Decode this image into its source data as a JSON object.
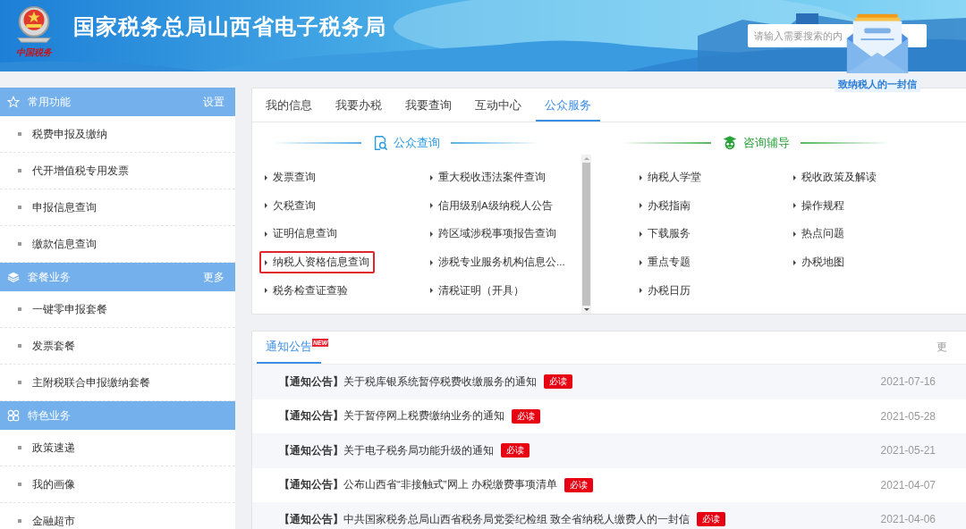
{
  "header": {
    "title": "国家税务总局山西省电子税务局",
    "logo_caption": "中国税务",
    "search": {
      "placeholder": "请输入需要搜索的内"
    },
    "letter": {
      "label": "致纳税人的一封信"
    }
  },
  "sidebar": [
    {
      "title": "常用功能",
      "kind": "star",
      "action": "设置",
      "items": [
        "税费申报及缴纳",
        "代开增值税专用发票",
        "申报信息查询",
        "缴款信息查询"
      ]
    },
    {
      "title": "套餐业务",
      "kind": "layers",
      "action": "更多",
      "items": [
        "一键零申报套餐",
        "发票套餐",
        "主附税联合申报缴纳套餐"
      ]
    },
    {
      "title": "特色业务",
      "kind": "grid",
      "items": [
        "政策速递",
        "我的画像",
        "金融超市"
      ]
    }
  ],
  "tabs": [
    {
      "label": "我的信息",
      "selected": false
    },
    {
      "label": "我要办税",
      "selected": false
    },
    {
      "label": "我要查询",
      "selected": false
    },
    {
      "label": "互动中心",
      "selected": false
    },
    {
      "label": "公众服务",
      "selected": true
    }
  ],
  "sections": [
    {
      "title": "公众查询",
      "kind": "query",
      "links": [
        {
          "label": "发票查询",
          "highlighted": false
        },
        {
          "label": "重大税收违法案件查询",
          "highlighted": false
        },
        {
          "label": "欠税查询",
          "highlighted": false
        },
        {
          "label": "信用级别A级纳税人公告",
          "highlighted": false
        },
        {
          "label": "证明信息查询",
          "highlighted": false
        },
        {
          "label": "跨区域涉税事项报告查询",
          "highlighted": false
        },
        {
          "label": "纳税人资格信息查询",
          "highlighted": true
        },
        {
          "label": "涉税专业服务机构信息公...",
          "highlighted": false
        },
        {
          "label": "税务检查证查验",
          "highlighted": false
        },
        {
          "label": "清税证明（开具）",
          "highlighted": false
        }
      ]
    },
    {
      "title": "咨询辅导",
      "kind": "advice",
      "links": [
        {
          "label": "纳税人学堂",
          "highlighted": false
        },
        {
          "label": "税收政策及解读",
          "highlighted": false
        },
        {
          "label": "办税指南",
          "highlighted": false
        },
        {
          "label": "操作规程",
          "highlighted": false
        },
        {
          "label": "下载服务",
          "highlighted": false
        },
        {
          "label": "热点问题",
          "highlighted": false
        },
        {
          "label": "重点专题",
          "highlighted": false
        },
        {
          "label": "办税地图",
          "highlighted": false
        },
        {
          "label": "办税日历",
          "highlighted": false
        }
      ]
    }
  ],
  "notices": {
    "tab": "通知公告",
    "badge": "NEW",
    "more": "更",
    "rows": [
      {
        "prefix": "【通知公告】",
        "title": "关于税库银系统暂停税费收缴服务的通知",
        "tag": "必读",
        "date": "2021-07-16"
      },
      {
        "prefix": "【通知公告】",
        "title": "关于暂停网上税费缴纳业务的通知",
        "tag": "必读",
        "date": "2021-05-28"
      },
      {
        "prefix": "【通知公告】",
        "title": "关于电子税务局功能升级的通知",
        "tag": "必读",
        "date": "2021-05-21"
      },
      {
        "prefix": "【通知公告】",
        "title": "公布山西省“非接触式”网上 办税缴费事项清单",
        "tag": "必读",
        "date": "2021-04-07"
      },
      {
        "prefix": "【通知公告】",
        "title": "中共国家税务总局山西省税务局党委纪检组 致全省纳税人缴费人的一封信",
        "tag": "必读",
        "date": "2021-04-06"
      }
    ]
  }
}
